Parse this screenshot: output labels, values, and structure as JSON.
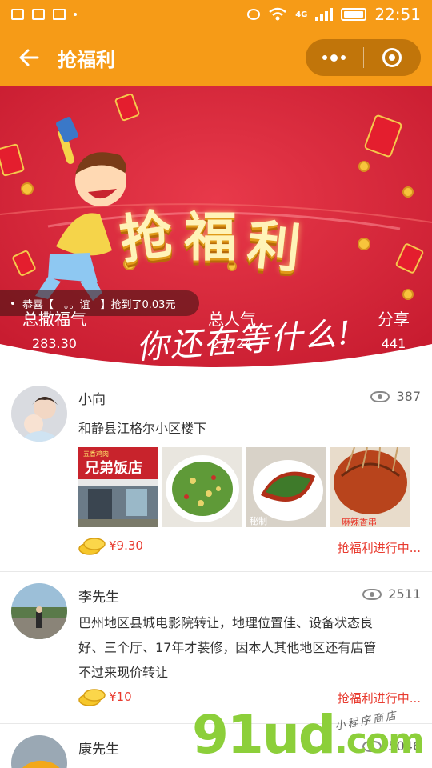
{
  "status_bar": {
    "time": "22:51",
    "network": "4G"
  },
  "navbar": {
    "title": "抢福利"
  },
  "banner": {
    "title_chars": [
      "抢",
      "福",
      "利"
    ],
    "slogan": "你还在等什么!",
    "ticker": "恭喜【　。。谊　】抢到了0.03元",
    "stats": [
      {
        "label": "总撒福气",
        "value": "283.30"
      },
      {
        "label": "总人气",
        "value": "27724"
      },
      {
        "label": "分享",
        "value": "441"
      }
    ]
  },
  "posts": [
    {
      "name": "小向",
      "views": "387",
      "text": "和静县江格尔小区楼下",
      "photos": [
        {
          "sign_text": "兄弟饭店",
          "sign_top": "五香鸡肉"
        },
        {},
        {
          "caption": "秘制"
        },
        {
          "caption": "麻辣香串"
        }
      ],
      "price": "¥9.30",
      "status": "抢福利进行中..."
    },
    {
      "name": "李先生",
      "views": "2511",
      "text_lines": [
        "巴州地区县城电影院转让，地理位置佳、设备状态良",
        "好、三个厅、17年才装修，因本人其他地区还有店管",
        "不过来现价转让"
      ],
      "price": "¥10",
      "status": "抢福利进行中..."
    },
    {
      "name": "康先生",
      "views": "5046"
    }
  ],
  "watermark": {
    "brand": "91ud",
    "suffix": ".com",
    "tagline": "小程序商店"
  },
  "colors": {
    "accent": "#f69b17",
    "red": "#e83a2e",
    "banner": "#d8283a"
  }
}
